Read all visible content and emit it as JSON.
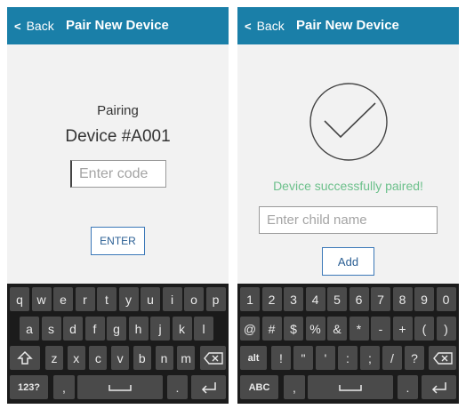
{
  "screen1": {
    "header": {
      "back_label": "Back",
      "title": "Pair New Device"
    },
    "pairing_label": "Pairing",
    "device_label": "Device #A001",
    "code_input": {
      "placeholder": "Enter code",
      "value": ""
    },
    "enter_button": "ENTER",
    "keyboard": {
      "row1": [
        "q",
        "w",
        "e",
        "r",
        "t",
        "y",
        "u",
        "i",
        "o",
        "p"
      ],
      "row2": [
        "a",
        "s",
        "d",
        "f",
        "g",
        "h",
        "j",
        "k",
        "l"
      ],
      "row3": [
        "z",
        "x",
        "c",
        "v",
        "b",
        "n",
        "m"
      ],
      "mode_key": "123?",
      "comma_key": ",",
      "period_key": "."
    }
  },
  "screen2": {
    "header": {
      "back_label": "Back",
      "title": "Pair New Device"
    },
    "success_message": "Device successfully paired!",
    "success_color": "#6cc08b",
    "child_name_input": {
      "placeholder": "Enter child name",
      "value": ""
    },
    "add_button": "Add",
    "keyboard": {
      "row1": [
        "1",
        "2",
        "3",
        "4",
        "5",
        "6",
        "7",
        "8",
        "9",
        "0"
      ],
      "row2": [
        "@",
        "#",
        "$",
        "%",
        "&",
        "*",
        "-",
        "+",
        "(",
        ")"
      ],
      "row3": [
        "!",
        "\"",
        "'",
        ":",
        ";",
        "/",
        "?"
      ],
      "alt_key": "alt",
      "mode_key": "ABC",
      "comma_key": ",",
      "period_key": "."
    }
  },
  "icons": {
    "back": "chevron-left-icon",
    "success": "checkmark-circle-icon",
    "shift": "shift-arrow-icon",
    "backspace": "backspace-icon",
    "space": "spacebar-icon",
    "enter": "return-icon"
  },
  "colors": {
    "header": "#1a7fa8",
    "keyboard_bg": "#1b1b1b",
    "key": "#4a4a4a",
    "button_border": "#3b78b8"
  }
}
